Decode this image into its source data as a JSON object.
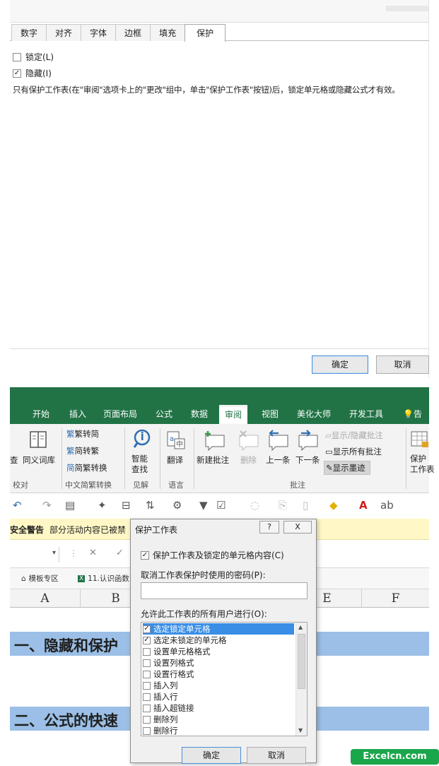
{
  "format_cells": {
    "tabs": [
      {
        "label": "数字"
      },
      {
        "label": "对齐"
      },
      {
        "label": "字体"
      },
      {
        "label": "边框"
      },
      {
        "label": "填充"
      },
      {
        "label": "保护",
        "active": true
      }
    ],
    "lock_label": "锁定(L)",
    "lock_checked": false,
    "hide_label": "隐藏(I)",
    "hide_checked": true,
    "note": "只有保护工作表(在\"审阅\"选项卡上的\"更改\"组中，单击\"保护工作表\"按钮)后，锁定单元格或隐藏公式才有效。",
    "ok_label": "确定",
    "cancel_label": "取消"
  },
  "ribbon": {
    "tabs": [
      "开始",
      "插入",
      "页面布局",
      "公式",
      "数据",
      "审阅",
      "视图",
      "美化大师",
      "开发工具",
      "告诉"
    ],
    "active_tab": "审阅",
    "proofing": {
      "items": [
        "查",
        "同义词库"
      ],
      "group": "校对"
    },
    "chinese": {
      "items": [
        "繁转简",
        "简转繁",
        "简繁转换"
      ],
      "group": "中文简繁转换"
    },
    "insights": {
      "item": "智能查找",
      "line1": "智能",
      "line2": "查找",
      "group": "见解"
    },
    "language": {
      "item": "翻译",
      "group": "语言"
    },
    "comments": {
      "new": "新建批注",
      "delete": "删除",
      "prev": "上一条",
      "next": "下一条",
      "show_hide": "显示/隐藏批注",
      "show_all": "显示所有批注",
      "show_ink": "显示墨迹",
      "group": "批注"
    },
    "protect": {
      "line1": "保护",
      "line2": "工作表"
    }
  },
  "security_warning": {
    "title": "安全警告",
    "text": "部分活动内容已被禁"
  },
  "doc_tabs": [
    "模板专区",
    "11.认识函数"
  ],
  "columns": [
    "A",
    "B",
    "E",
    "F"
  ],
  "sheet_rows": [
    {
      "text": "一、隐藏和保护"
    },
    {
      "text": "二、公式的快速"
    }
  ],
  "protect_sheet": {
    "title": "保护工作表",
    "help": "?",
    "close": "X",
    "protect_label": "保护工作表及锁定的单元格内容(C)",
    "protect_checked": true,
    "password_label": "取消工作表保护时使用的密码(P):",
    "password_value": "",
    "allow_label": "允许此工作表的所有用户进行(O):",
    "permissions": [
      {
        "label": "选定锁定单元格",
        "checked": true,
        "selected": true
      },
      {
        "label": "选定未锁定的单元格",
        "checked": true
      },
      {
        "label": "设置单元格格式",
        "checked": false
      },
      {
        "label": "设置列格式",
        "checked": false
      },
      {
        "label": "设置行格式",
        "checked": false
      },
      {
        "label": "插入列",
        "checked": false
      },
      {
        "label": "插入行",
        "checked": false
      },
      {
        "label": "插入超链接",
        "checked": false
      },
      {
        "label": "删除列",
        "checked": false
      },
      {
        "label": "删除行",
        "checked": false
      }
    ],
    "ok_label": "确定",
    "cancel_label": "取消"
  },
  "watermark": "Excelcn.com",
  "colors": {
    "excel_green": "#217346",
    "selection_blue": "#3a8ee6",
    "band_blue": "#9bbfe6"
  }
}
